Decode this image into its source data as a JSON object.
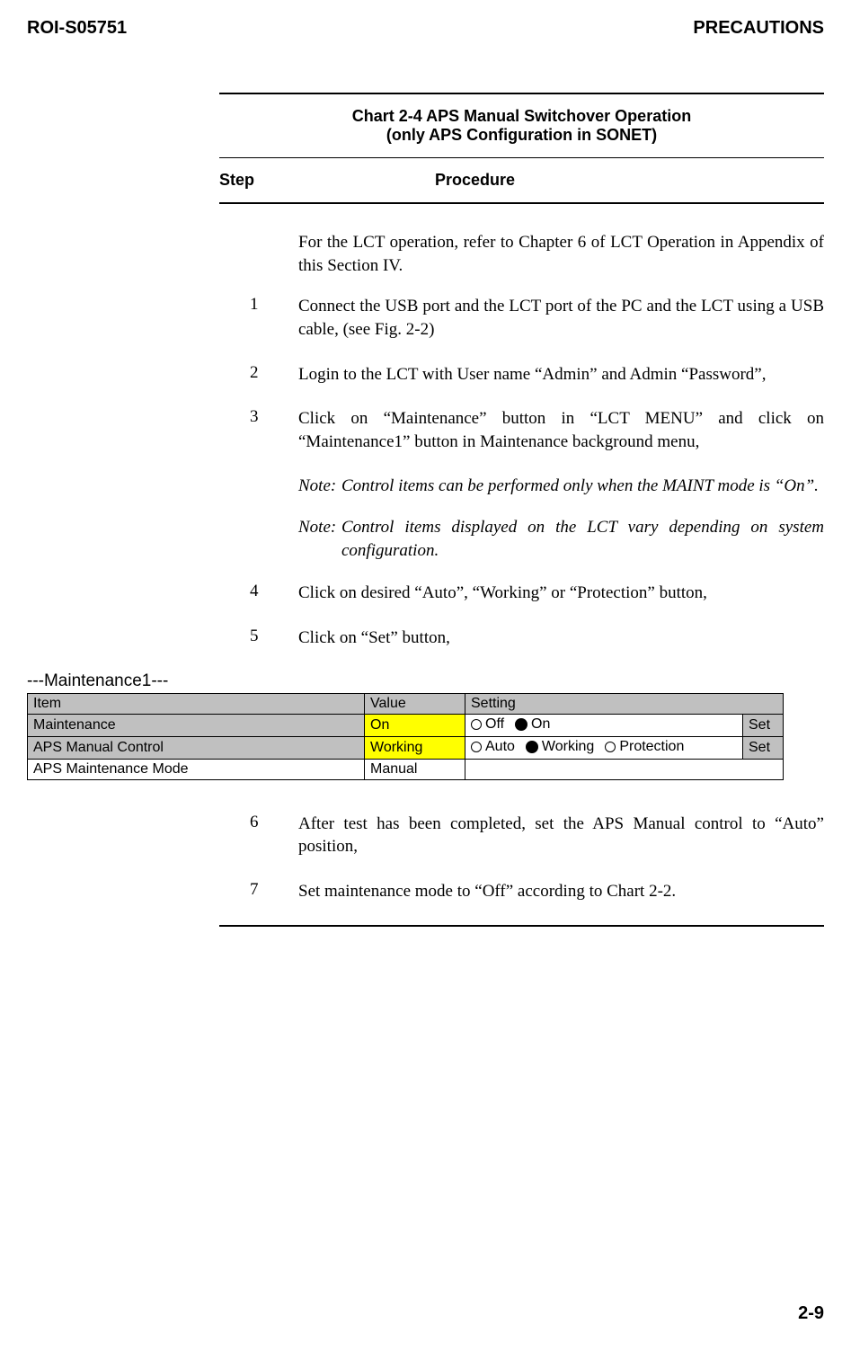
{
  "header": {
    "left": "ROI-S05751",
    "right": "PRECAUTIONS"
  },
  "chart": {
    "title_line1": "Chart 2-4  APS Manual Switchover Operation",
    "title_line2": "(only APS Configuration in SONET)",
    "step_label": "Step",
    "procedure_label": "Procedure",
    "intro": "For the LCT operation, refer to Chapter 6 of LCT Operation in Appendix of this Section IV.",
    "steps_top": [
      {
        "num": "1",
        "text": "Connect the USB port and the LCT port of the PC and the LCT using a USB cable, (see Fig. 2-2)"
      },
      {
        "num": "2",
        "text": "Login to the LCT with User name “Admin” and Admin “Password”,"
      },
      {
        "num": "3",
        "text": "Click on “Maintenance” button in “LCT MENU” and click on “Maintenance1” button in Maintenance background menu,"
      }
    ],
    "note1_label": "Note:",
    "note1_body": "Control items can be performed only when the MAINT mode is “On”.",
    "note2_label": "Note:",
    "note2_body": "Control items displayed on the LCT vary depending on system configuration.",
    "steps_mid": [
      {
        "num": "4",
        "text": "Click on desired “Auto”, “Working” or “Protection” button,"
      },
      {
        "num": "5",
        "text": "Click on “Set” button,"
      }
    ],
    "steps_bottom": [
      {
        "num": "6",
        "text": "After test has been completed, set the APS Manual control to “Auto” position,"
      },
      {
        "num": "7",
        "text": "Set maintenance mode to “Off” according to Chart 2-2."
      }
    ]
  },
  "maint_table": {
    "section_title": "---Maintenance1---",
    "headers": {
      "item": "Item",
      "value": "Value",
      "setting": "Setting"
    },
    "rows": [
      {
        "item": "Maintenance",
        "value": "On",
        "options": [
          {
            "label": "Off",
            "selected": false
          },
          {
            "label": "On",
            "selected": true
          }
        ],
        "set": "Set",
        "value_highlight": true
      },
      {
        "item": "APS Manual Control",
        "value": "Working",
        "options": [
          {
            "label": "Auto",
            "selected": false
          },
          {
            "label": "Working",
            "selected": true
          },
          {
            "label": "Protection",
            "selected": false
          }
        ],
        "set": "Set",
        "value_highlight": true
      },
      {
        "item": "APS Maintenance Mode",
        "value": "Manual",
        "options": null,
        "set": null,
        "value_highlight": false
      }
    ]
  },
  "footer": {
    "page_number": "2-9"
  }
}
